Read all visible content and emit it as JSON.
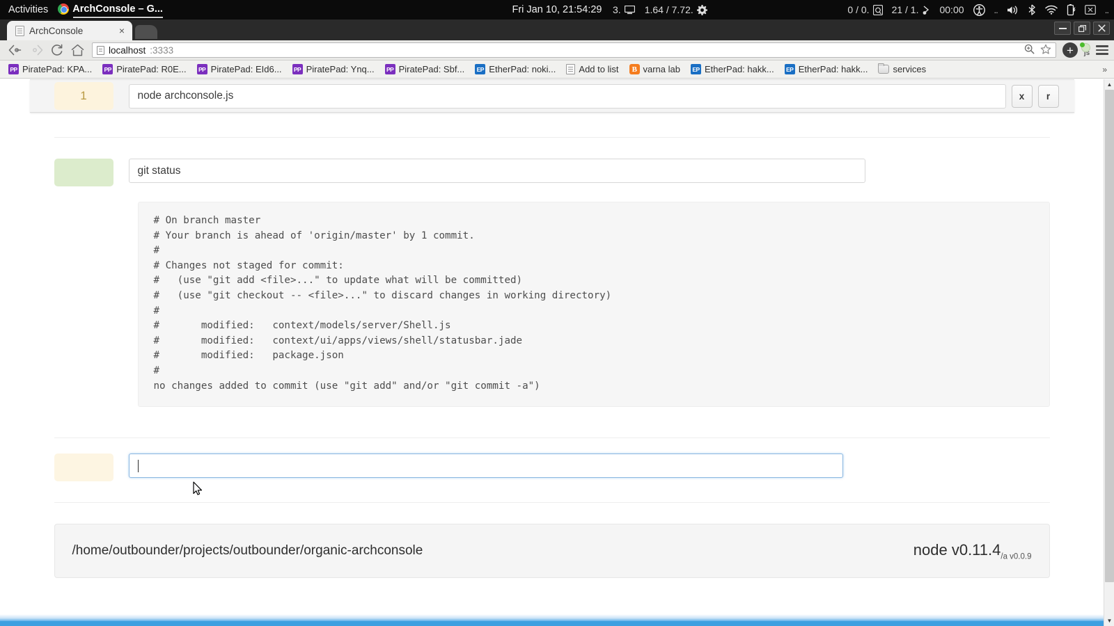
{
  "desktop": {
    "activities_label": "Activities",
    "active_app": "ArchConsole – G...",
    "clock": "Fri Jan 10, 21:54:29",
    "tray": [
      {
        "name": "display-stat",
        "label": "3."
      },
      {
        "name": "memory-stat",
        "label": "1.64 / 7.72."
      },
      {
        "name": "network-stat",
        "label": "0 / 0."
      },
      {
        "name": "disk-stat",
        "label": "21 / 1."
      },
      {
        "name": "timer",
        "label": "00:00"
      },
      {
        "name": "ellipsis",
        "label": ".."
      },
      {
        "name": "trailing-ellipsis",
        "label": ".."
      }
    ]
  },
  "browser": {
    "tab": {
      "title": "ArchConsole",
      "close_label": "×"
    },
    "window_controls": {
      "minimize": "–",
      "maximize": "❐",
      "close": "✕"
    },
    "nav": {
      "back": "back-arrow",
      "forward": "forward-arrow",
      "reload": "reload-arrow",
      "home": "home-house"
    },
    "omnibox": {
      "host": "localhost",
      "port": ":3333",
      "zoom_icon": "zoom-magnifier-icon",
      "bookmark_icon": "star-icon"
    },
    "extensions": [
      {
        "name": "add-extension",
        "label": "+"
      },
      {
        "name": "js-toggle",
        "label": "js"
      }
    ],
    "menu_label": "chrome-menu",
    "bookmarks": [
      {
        "icon": "pp",
        "label": "PiratePad: KPA..."
      },
      {
        "icon": "pp",
        "label": "PiratePad: R0E..."
      },
      {
        "icon": "pp",
        "label": "PiratePad: EId6..."
      },
      {
        "icon": "pp",
        "label": "PiratePad: Ynq..."
      },
      {
        "icon": "pp",
        "label": "PiratePad: Sbf..."
      },
      {
        "icon": "ep",
        "label": "EtherPad: noki..."
      },
      {
        "icon": "doc",
        "label": "Add to list"
      },
      {
        "icon": "blogger",
        "label": "varna lab"
      },
      {
        "icon": "ep",
        "label": "EtherPad: hakk..."
      },
      {
        "icon": "ep",
        "label": "EtherPad: hakk..."
      },
      {
        "icon": "folder",
        "label": "services"
      }
    ],
    "bookmarks_overflow": "»"
  },
  "console": {
    "cells": [
      {
        "gutter": "1",
        "gutter_style": "yellow",
        "command": "node archconsole.js",
        "buttons": [
          {
            "name": "kill-cell-button",
            "label": "x"
          },
          {
            "name": "rerun-cell-button",
            "label": "r"
          }
        ]
      },
      {
        "gutter": "",
        "gutter_style": "green",
        "command": "git status",
        "buttons": []
      }
    ],
    "output": "# On branch master\n# Your branch is ahead of 'origin/master' by 1 commit.\n#\n# Changes not staged for commit:\n#   (use \"git add <file>...\" to update what will be committed)\n#   (use \"git checkout -- <file>...\" to discard changes in working directory)\n#\n#       modified:   context/models/server/Shell.js\n#       modified:   context/ui/apps/views/shell/statusbar.jade\n#       modified:   package.json\n#\nno changes added to commit (use \"git add\" and/or \"git commit -a\")",
    "prompt": {
      "gutter": "",
      "gutter_style": "cream",
      "value": "",
      "placeholder": ""
    }
  },
  "statusbar": {
    "cwd": "/home/outbounder/projects/outbounder/organic-archconsole",
    "node_version": "node v0.11.4",
    "app_version": "/a v0.0.9"
  },
  "colors": {
    "gutter_yellow": "#fdf3dd",
    "gutter_green": "#dceccc",
    "gutter_cream": "#fdf5e2",
    "focus_blue": "#8cb8e0",
    "status_blue": "#3d9fe0"
  }
}
